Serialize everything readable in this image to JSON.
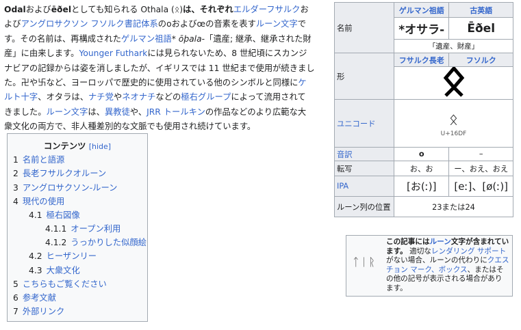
{
  "intro": {
    "s1_bold": "Odal",
    "s1_a": "および",
    "s1_bold2": "ēðel",
    "s1_b": "としても知られる Othala (",
    "s1_rune": "ᛟ",
    "s1_c": ")",
    "s1_d": "は、それぞれ",
    "elder": "エルダーフサルク",
    "s1_e": "お",
    "s1_f": "よび",
    "anglo": "アングロサクソン フソルク",
    "s1_g": "書記体系",
    "s1_h": "のoおよびœの音素を表す",
    "rune_script": "ルーン文字",
    "s1_i": "で",
    "s1_j": "す。その名前は、再構成された",
    "germanic": "ゲルマン祖語",
    "s1_k": "* ",
    "s1_k_it": "ōþala",
    "s1_l": "-「遺産; 継承、継承された財",
    "s1_m": "産」に由来します。",
    "younger": "Younger Futhark",
    "s1_n": "には見られないため、8 世紀頃にスカンジ",
    "s1_o": "ナビアの記録からは姿を消しましたが、イギリスでは 11 世紀まで使用が続きまし",
    "s1_p": "た。卍や卐など、ヨーロッパで歴史的に使用されている他のシンボルと同様に",
    "celtic": "ケ",
    "s1_q1": "ルト十字",
    "s1_q": "、オタラは、",
    "nazi": "ナチ党",
    "s1_r": "や",
    "neonazi": "ネオナチ",
    "s1_s": "などの",
    "farright": "極右グループ",
    "s1_t": "によって流用されて",
    "s1_u": "きました。",
    "runes": "ルーン文字",
    "s1_v": "は、",
    "pagan": "異教徒",
    "s1_w": "や、",
    "tolkien": "JRR トールキン",
    "s1_x": "の作品などのより広範な大",
    "s1_y": "衆文化の両方で、非人種差別的な文脈でも使用され続けています。"
  },
  "toc": {
    "title": "コンテンツ",
    "hide": "[hide]",
    "items": [
      {
        "num": "1",
        "label": "名前と語源"
      },
      {
        "num": "2",
        "label": "長老フサルクオルーン"
      },
      {
        "num": "3",
        "label": "アングロサクソン-ルーン"
      },
      {
        "num": "4",
        "label": "現代の使用"
      },
      {
        "num": "4.1",
        "label": "極右図像"
      },
      {
        "num": "4.1.1",
        "label": "オープン利用"
      },
      {
        "num": "4.1.2",
        "label": "うっかりした似顔絵"
      },
      {
        "num": "4.2",
        "label": "ヒーザンリー"
      },
      {
        "num": "4.3",
        "label": "大衆文化"
      },
      {
        "num": "5",
        "label": "こちらもご覧ください"
      },
      {
        "num": "6",
        "label": "参考文献"
      },
      {
        "num": "7",
        "label": "外部リンク"
      }
    ]
  },
  "infobox": {
    "h_proto": "ゲルマン祖語",
    "h_oe": "古英語",
    "name_label": "名前",
    "name_proto": "*オサラ-",
    "name_oe": "Ēðel",
    "meaning": "「遺産、財産」",
    "h_elder": "フサルク長老",
    "h_futhorc": "フソルク",
    "shape_label": "形",
    "rune_glyph": "ᛟ",
    "unicode_label": "ユニコード",
    "unicode_glyph": "ᛟ",
    "unicode_code": "U+16DF",
    "translit_label": "音訳",
    "translit_a": "o",
    "translit_b": "–",
    "trans_label": "転写",
    "trans_a": "お、お",
    "trans_b": "ー、おえ、おえ",
    "ipa_label": "IPA",
    "ipa_a": "[お(ː)]",
    "ipa_b": "[eː]、[ø(ː)]",
    "pos_label": "ルーン列の位置",
    "pos_value": "23または24"
  },
  "notice": {
    "icon_text": "ᛏᛁᚱ",
    "t1": "この記事には",
    "t2": "ルーン",
    "t3": "文字が含まれています。",
    "t4": "適切な",
    "t5": "レンダリング サポート",
    "t6": "がない場合、ルーンの代わりに",
    "t7": "クエスチョン マーク、ボックス",
    "t8": "、またはその他の記号が表示される場合があります。"
  }
}
